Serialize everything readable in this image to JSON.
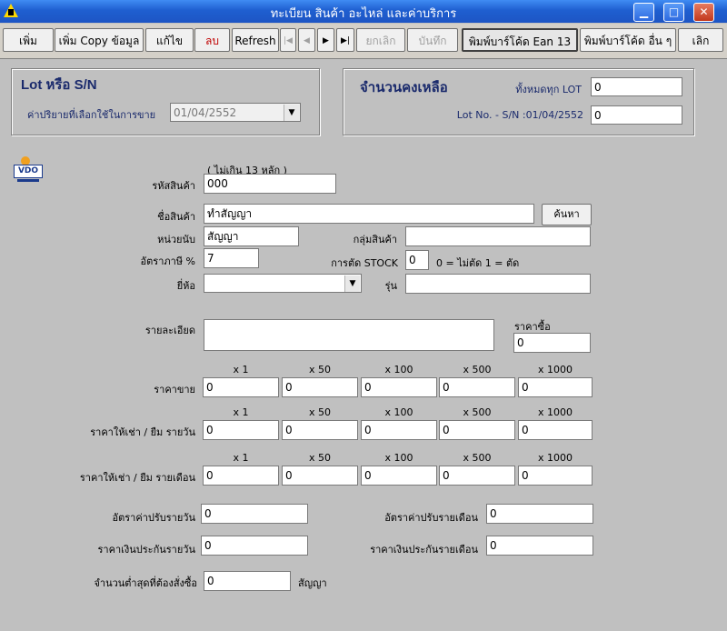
{
  "window": {
    "title": "ทะเบียน สินค้า อะไหล่ และค่าบริการ",
    "minimize": "▁",
    "maximize": "□",
    "close": "✕"
  },
  "toolbar": {
    "add": "เพิ่ม",
    "add_copy": "เพิ่ม Copy ข้อมูล",
    "edit": "แก้ไข",
    "delete": "ลบ",
    "refresh": "Refresh",
    "first": "|◀",
    "prev": "◀",
    "next": "▶",
    "last": "▶|",
    "cancel": "ยกเลิก",
    "save": "บันทึก",
    "print_ean13": "พิมพ์บาร์โค้ด Ean 13",
    "print_other": "พิมพ์บาร์โค้ด อื่น ๆ",
    "exit": "เลิก"
  },
  "lot_group": {
    "title": "Lot หรือ S/N",
    "default_label": "ค่าปริยายที่เลือกใช้ในการขาย",
    "default_value": "01/04/2552"
  },
  "stock_group": {
    "title": "จำนวนคงเหลือ",
    "all_lot_label": "ทั้งหมดทุก LOT",
    "all_lot_value": "0",
    "lot_sn_label": "Lot No. - S/N :01/04/2552",
    "lot_sn_value": "0"
  },
  "logo_text": "VDO",
  "product": {
    "code_hint": "( ไม่เกิน 13 หลัก )",
    "code_label": "รหัสสินค้า",
    "code_value": "000",
    "name_label": "ชื่อสินค้า",
    "name_value": "ทำสัญญา",
    "search_button": "ค้นหา",
    "unit_label": "หน่วยนับ",
    "unit_value": "สัญญา",
    "group_label": "กลุ่มสินค้า",
    "group_value": "",
    "tax_label": "อัตราภาษี %",
    "tax_value": "7",
    "stock_cut_label": "การตัด STOCK",
    "stock_cut_value": "0",
    "stock_cut_note": "0 = ไม่ตัด   1 = ตัด",
    "brand_label": "ยี่ห้อ",
    "brand_value": "",
    "model_label": "รุ่น",
    "model_value": "",
    "detail_label": "รายละเอียด",
    "detail_value": "",
    "cost_label": "ราคาซื้อ",
    "cost_value": "0"
  },
  "price_headers": [
    "x 1",
    "x 50",
    "x 100",
    "x 500",
    "x 1000"
  ],
  "price_rows": [
    {
      "label": "ราคาขาย",
      "values": [
        "0",
        "0",
        "0",
        "0",
        "0"
      ]
    },
    {
      "label": "ราคาให้เช่า / ยืม รายวัน",
      "values": [
        "0",
        "0",
        "0",
        "0",
        "0"
      ]
    },
    {
      "label": "ราคาให้เช่า / ยืม รายเดือน",
      "values": [
        "0",
        "0",
        "0",
        "0",
        "0"
      ]
    }
  ],
  "rates": {
    "daily_fine_label": "อัตราค่าปรับรายวัน",
    "daily_fine_value": "0",
    "monthly_fine_label": "อัตราค่าปรับรายเดือน",
    "monthly_fine_value": "0",
    "daily_deposit_label": "ราคาเงินประกันรายวัน",
    "daily_deposit_value": "0",
    "monthly_deposit_label": "ราคาเงินประกันรายเดือน",
    "monthly_deposit_value": "0",
    "min_order_label": "จำนวนต่ำสุดที่ต้องสั่งซื้อ",
    "min_order_value": "0",
    "min_order_unit": "สัญญา"
  }
}
